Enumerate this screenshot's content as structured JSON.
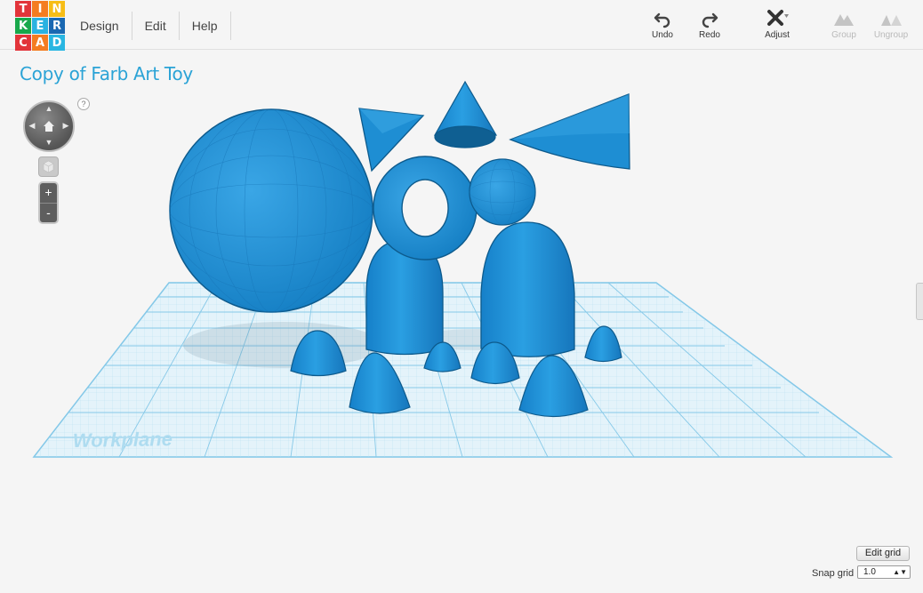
{
  "logo": {
    "letters": [
      "T",
      "I",
      "N",
      "K",
      "E",
      "R",
      "C",
      "A",
      "D"
    ],
    "colors": [
      "#e2343a",
      "#f47c20",
      "#f7bd16",
      "#18a84b",
      "#2ab2e1",
      "#1a68b2",
      "#e2343a",
      "#f47c20",
      "#29b6e2"
    ]
  },
  "menu": {
    "design": "Design",
    "edit": "Edit",
    "help": "Help"
  },
  "toolbar": {
    "undo": "Undo",
    "redo": "Redo",
    "adjust": "Adjust",
    "group": "Group",
    "ungroup": "Ungroup"
  },
  "title": "Copy of Farb Art Toy",
  "nav": {
    "help": "?",
    "zoom_in": "+",
    "zoom_out": "-"
  },
  "workplane_label": "Workplane",
  "grid_controls": {
    "edit_grid": "Edit grid",
    "snap_grid_label": "Snap grid",
    "snap_grid_value": "1.0"
  },
  "colors": {
    "accent": "#2ba3d6",
    "shape_fill": "#1f8fd3",
    "grid_line": "#8ccbe8"
  },
  "icons": [
    "undo-icon",
    "redo-icon",
    "adjust-icon",
    "group-icon",
    "ungroup-icon",
    "home-icon"
  ]
}
